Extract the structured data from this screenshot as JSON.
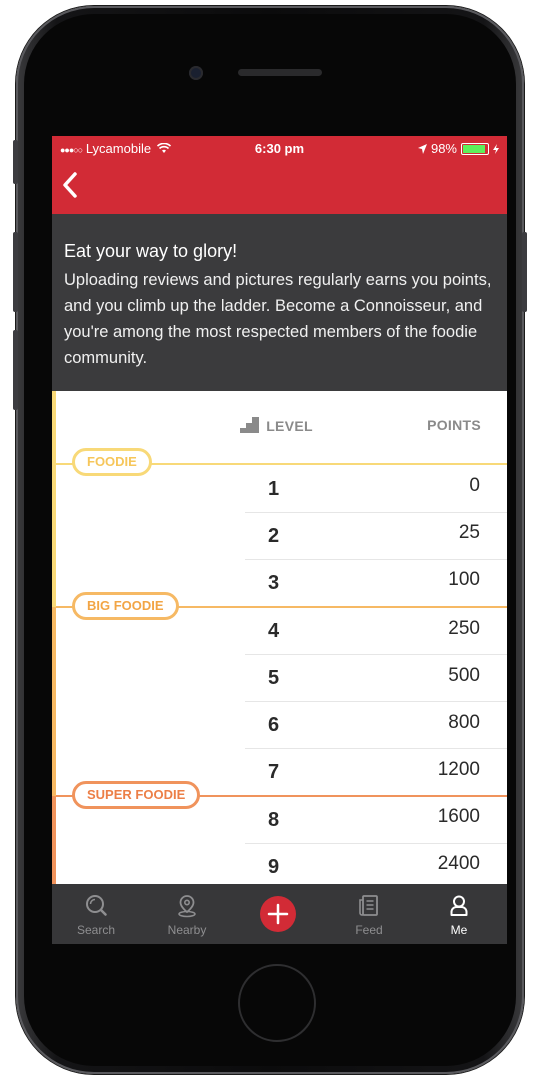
{
  "status": {
    "carrier": "Lycamobile",
    "signal": "●●●○○",
    "time": "6:30 pm",
    "battery_text": "98%",
    "battery_level": 0.98
  },
  "intro": {
    "title": "Eat your way to glory!",
    "body": "Uploading reviews and pictures regularly earns you points, and you climb up the ladder. Become a Connoisseur, and you're among the most respected members of the foodie community."
  },
  "ladder": {
    "level_header": "LEVEL",
    "points_header": "POINTS",
    "tiers": [
      {
        "name": "FOODIE",
        "color": "#f8d978"
      },
      {
        "name": "BIG FOODIE",
        "color": "#f6b964"
      },
      {
        "name": "SUPER FOODIE",
        "color": "#f0935c"
      }
    ],
    "rows": [
      {
        "level": "1",
        "points": "0"
      },
      {
        "level": "2",
        "points": "25"
      },
      {
        "level": "3",
        "points": "100"
      },
      {
        "level": "4",
        "points": "250"
      },
      {
        "level": "5",
        "points": "500"
      },
      {
        "level": "6",
        "points": "800"
      },
      {
        "level": "7",
        "points": "1200"
      },
      {
        "level": "8",
        "points": "1600"
      },
      {
        "level": "9",
        "points": "2400"
      }
    ]
  },
  "tabs": [
    {
      "label": "Search",
      "icon": "search-icon"
    },
    {
      "label": "Nearby",
      "icon": "location-pin-icon"
    },
    {
      "label": "",
      "icon": "plus-icon"
    },
    {
      "label": "Feed",
      "icon": "feed-icon"
    },
    {
      "label": "Me",
      "icon": "user-icon",
      "active": true
    }
  ],
  "colors": {
    "brand_red": "#d22b36",
    "dark_panel": "#3b3b3d",
    "tab_bar": "#373739"
  }
}
